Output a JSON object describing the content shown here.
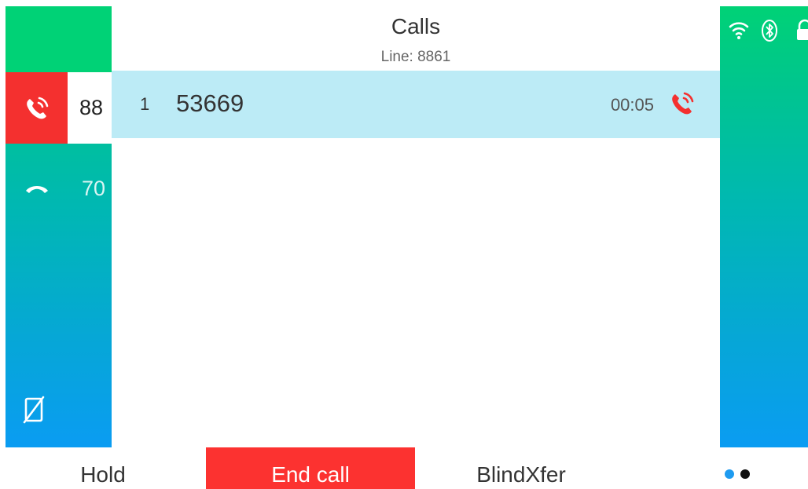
{
  "header": {
    "title": "Calls",
    "subtitle": "Line: 8861"
  },
  "line_keys": [
    {
      "label": "88",
      "icon": "phone-ringing-icon",
      "state": "active",
      "color": "#f4302f"
    },
    {
      "label": "70",
      "icon": "handset-icon",
      "state": "idle"
    }
  ],
  "left_bottom_icon": "do-not-disturb-icon",
  "call_list": [
    {
      "index": "1",
      "number": "53669",
      "duration": "00:05",
      "icon": "phone-ringing-icon",
      "icon_color": "#f4302f"
    }
  ],
  "status_icons": [
    "wifi-icon",
    "bluetooth-icon",
    "lock-icon"
  ],
  "softkeys": {
    "hold": "Hold",
    "end_call": "End call",
    "blind_transfer": "BlindXfer"
  },
  "page_indicator": {
    "pages": 2,
    "current": 1
  },
  "colors": {
    "accent_green": "#00d276",
    "accent_blue": "#0a9cf2",
    "selected_row": "#bcebf6",
    "end_call": "#fc3230"
  }
}
